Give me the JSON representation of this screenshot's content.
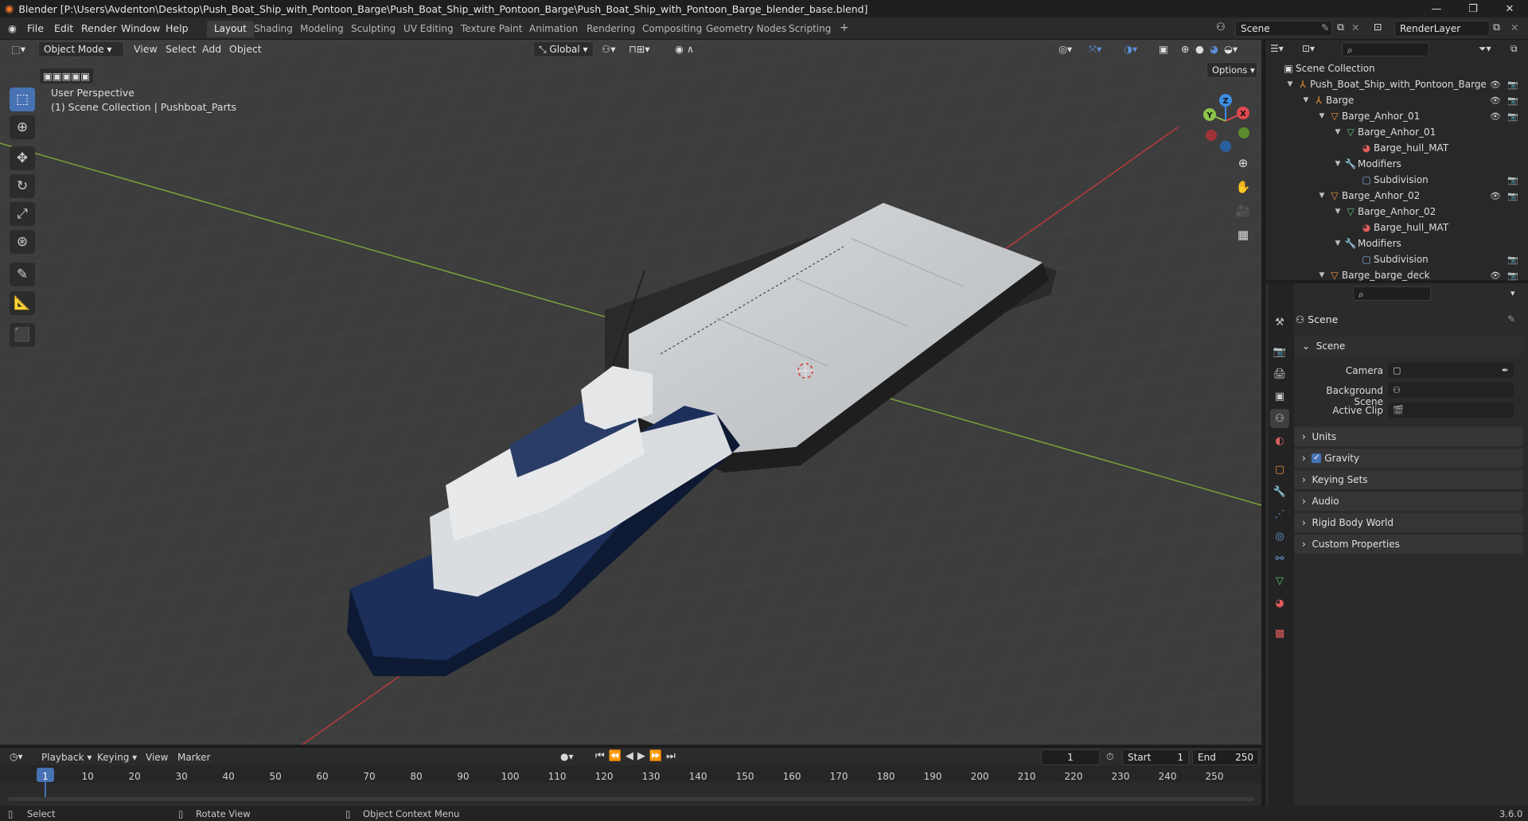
{
  "titlebar": {
    "title": "Blender [P:\\Users\\Avdenton\\Desktop\\Push_Boat_Ship_with_Pontoon_Barge\\Push_Boat_Ship_with_Pontoon_Barge\\Push_Boat_Ship_with_Pontoon_Barge_blender_base.blend]",
    "minimize": "—",
    "maximize": "❐",
    "close": "✕"
  },
  "menubar": {
    "items": [
      "File",
      "Edit",
      "Render",
      "Window",
      "Help"
    ],
    "workspaces": [
      "Layout",
      "Shading",
      "Modeling",
      "Sculpting",
      "UV Editing",
      "Texture Paint",
      "Animation",
      "Rendering",
      "Compositing",
      "Geometry Nodes",
      "Scripting"
    ],
    "active_workspace": "Layout",
    "add_workspace": "+",
    "scene": "Scene",
    "view_layer": "RenderLayer"
  },
  "viewport_header": {
    "mode": "Object Mode",
    "menus": [
      "View",
      "Select",
      "Add",
      "Object"
    ],
    "orientation": "Global",
    "options": "Options"
  },
  "viewport": {
    "perspective": "User Perspective",
    "collection_info": "(1) Scene Collection | Pushboat_Parts",
    "gizmo_axes": [
      "X",
      "Y",
      "Z"
    ]
  },
  "outliner": {
    "rows": [
      {
        "label": "Scene Collection",
        "icon": "collection-icon"
      },
      {
        "label": "Push_Boat_Ship_with_Pontoon_Barge",
        "icon": "empty-icon"
      },
      {
        "label": "Barge",
        "icon": "empty-icon"
      },
      {
        "label": "Barge_Anhor_01",
        "icon": "mesh-object-icon"
      },
      {
        "label": "Barge_Anhor_01",
        "icon": "mesh-data-icon"
      },
      {
        "label": "Barge_hull_MAT",
        "icon": "material-icon"
      },
      {
        "label": "Modifiers",
        "icon": "wrench-icon"
      },
      {
        "label": "Subdivision",
        "icon": "subdivision-icon"
      },
      {
        "label": "Barge_Anhor_02",
        "icon": "mesh-object-icon"
      },
      {
        "label": "Barge_Anhor_02",
        "icon": "mesh-data-icon"
      },
      {
        "label": "Barge_hull_MAT",
        "icon": "material-icon"
      },
      {
        "label": "Modifiers",
        "icon": "wrench-icon"
      },
      {
        "label": "Subdivision",
        "icon": "subdivision-icon"
      },
      {
        "label": "Barge_barge_deck",
        "icon": "mesh-object-icon"
      }
    ]
  },
  "properties": {
    "context": "Scene",
    "section": "Scene",
    "fields": [
      {
        "label": "Camera",
        "value": ""
      },
      {
        "label": "Background Scene",
        "value": ""
      },
      {
        "label": "Active Clip",
        "value": ""
      }
    ],
    "panels": [
      "Units",
      "Gravity",
      "Keying Sets",
      "Audio",
      "Rigid Body World",
      "Custom Properties"
    ],
    "gravity_enabled": true
  },
  "timeline": {
    "menus": [
      "Playback",
      "Keying",
      "View",
      "Marker"
    ],
    "current_frame": "1",
    "start_label": "Start",
    "start": "1",
    "end_label": "End",
    "end": "250",
    "ticks": [
      "1",
      "10",
      "20",
      "30",
      "40",
      "50",
      "60",
      "70",
      "80",
      "90",
      "100",
      "110",
      "120",
      "130",
      "140",
      "150",
      "160",
      "170",
      "180",
      "190",
      "200",
      "210",
      "220",
      "230",
      "240",
      "250"
    ]
  },
  "statusbar": {
    "select": "Select",
    "rotate": "Rotate View",
    "context_menu": "Object Context Menu",
    "version": "3.6.0"
  },
  "colors": {
    "accent": "#4772b3",
    "x_axis": "#e0484e",
    "y_axis": "#8bc34a",
    "z_axis": "#3d8ee6",
    "boat_hull": "#1c2f5a"
  }
}
